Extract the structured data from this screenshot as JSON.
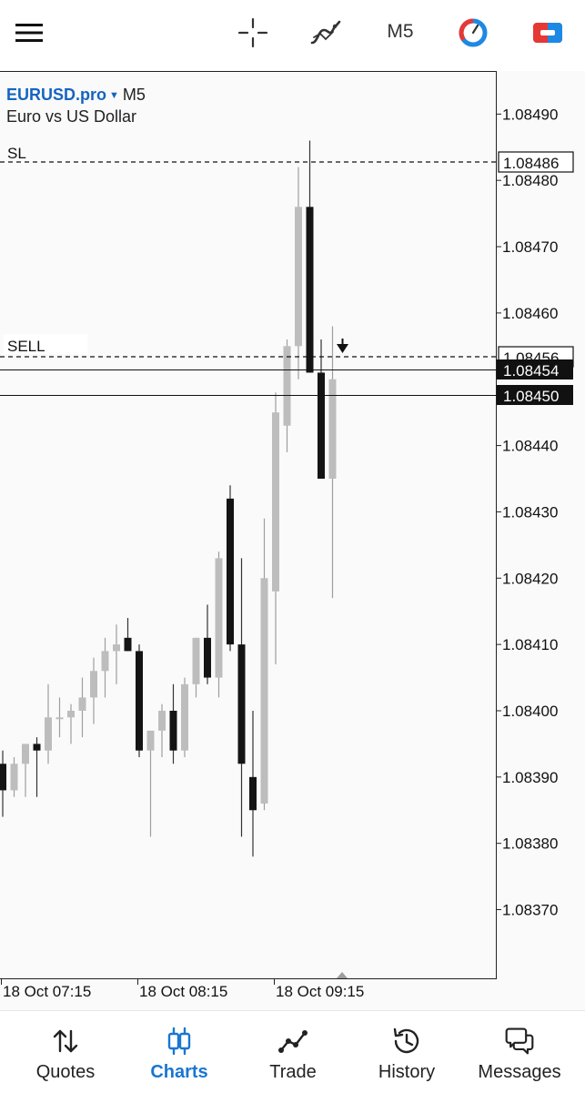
{
  "toolbar": {
    "menu_icon": "hamburger-menu-icon",
    "crosshair_icon": "crosshair-icon",
    "indicators_icon": "indicator-curve-icon",
    "timeframe": "M5",
    "oneclick_icon": "one-click-trading-icon",
    "trade_icon": "trade-ticket-icon",
    "colors": {
      "oneclick_blue": "#1e88e5",
      "oneclick_red": "#e53935",
      "trade_red": "#e53935",
      "trade_blue": "#1e88e5"
    }
  },
  "symbol": {
    "name": "EURUSD.pro",
    "dropdown_icon": "caret-down-icon",
    "timeframe": "M5",
    "description": "Euro vs US Dollar"
  },
  "levels": {
    "sl_label": "SL",
    "sl_price": "1.08486",
    "sell_label": "SELL",
    "sell_price": "1.08456",
    "ask_price": "1.08454",
    "bid_price": "1.08450"
  },
  "chart_data": {
    "type": "candlestick",
    "symbol": "EURUSD.pro",
    "timeframe": "M5",
    "y_ticks": [
      "1.08490",
      "1.08480",
      "1.08470",
      "1.08460",
      "1.08440",
      "1.08430",
      "1.08420",
      "1.08410",
      "1.08400",
      "1.08390",
      "1.08380",
      "1.08370"
    ],
    "x_ticks": [
      "18 Oct 07:15",
      "18 Oct 08:15",
      "18 Oct 09:15"
    ],
    "ylim": [
      1.083595,
      1.084965
    ],
    "candles": [
      {
        "o": 1.08392,
        "h": 1.08394,
        "l": 1.08384,
        "c": 1.08388
      },
      {
        "o": 1.08388,
        "h": 1.08393,
        "l": 1.08387,
        "c": 1.08392
      },
      {
        "o": 1.08392,
        "h": 1.08395,
        "l": 1.08387,
        "c": 1.08395
      },
      {
        "o": 1.08395,
        "h": 1.08396,
        "l": 1.08387,
        "c": 1.08394
      },
      {
        "o": 1.08394,
        "h": 1.08404,
        "l": 1.08392,
        "c": 1.08399
      },
      {
        "o": 1.08399,
        "h": 1.08402,
        "l": 1.08396,
        "c": 1.08399
      },
      {
        "o": 1.08399,
        "h": 1.08401,
        "l": 1.08395,
        "c": 1.084
      },
      {
        "o": 1.084,
        "h": 1.08405,
        "l": 1.08396,
        "c": 1.08402
      },
      {
        "o": 1.08402,
        "h": 1.08408,
        "l": 1.08398,
        "c": 1.08406
      },
      {
        "o": 1.08406,
        "h": 1.08411,
        "l": 1.08402,
        "c": 1.08409
      },
      {
        "o": 1.08409,
        "h": 1.08413,
        "l": 1.08404,
        "c": 1.0841
      },
      {
        "o": 1.08411,
        "h": 1.08414,
        "l": 1.08409,
        "c": 1.08409
      },
      {
        "o": 1.08409,
        "h": 1.0841,
        "l": 1.08393,
        "c": 1.08394
      },
      {
        "o": 1.08394,
        "h": 1.08396,
        "l": 1.08381,
        "c": 1.08397
      },
      {
        "o": 1.08397,
        "h": 1.08401,
        "l": 1.08393,
        "c": 1.084
      },
      {
        "o": 1.084,
        "h": 1.08404,
        "l": 1.08392,
        "c": 1.08394
      },
      {
        "o": 1.08394,
        "h": 1.08405,
        "l": 1.08393,
        "c": 1.08404
      },
      {
        "o": 1.08404,
        "h": 1.08411,
        "l": 1.08402,
        "c": 1.08411
      },
      {
        "o": 1.08411,
        "h": 1.08416,
        "l": 1.08404,
        "c": 1.08405
      },
      {
        "o": 1.08405,
        "h": 1.08424,
        "l": 1.08402,
        "c": 1.08423
      },
      {
        "o": 1.08432,
        "h": 1.08434,
        "l": 1.08409,
        "c": 1.0841
      },
      {
        "o": 1.0841,
        "h": 1.08423,
        "l": 1.08381,
        "c": 1.08392
      },
      {
        "o": 1.0839,
        "h": 1.084,
        "l": 1.08378,
        "c": 1.08385
      },
      {
        "o": 1.08386,
        "h": 1.08429,
        "l": 1.08385,
        "c": 1.0842
      },
      {
        "o": 1.08418,
        "h": 1.08448,
        "l": 1.08407,
        "c": 1.08445
      },
      {
        "o": 1.08443,
        "h": 1.08456,
        "l": 1.08439,
        "c": 1.08455
      },
      {
        "o": 1.08455,
        "h": 1.08482,
        "l": 1.0845,
        "c": 1.08476
      },
      {
        "o": 1.08476,
        "h": 1.08486,
        "l": 1.08451,
        "c": 1.08451
      },
      {
        "o": 1.08451,
        "h": 1.08456,
        "l": 1.08435,
        "c": 1.08435
      },
      {
        "o": 1.08435,
        "h": 1.08458,
        "l": 1.08417,
        "c": 1.0845
      }
    ],
    "colors": {
      "bull": "#bdbdbd",
      "bear": "#141414",
      "wick": "#333333",
      "line": "#111111",
      "background": "#fafafa"
    }
  },
  "nav": [
    {
      "label": "Quotes",
      "icon": "quotes-arrows-icon",
      "active": false
    },
    {
      "label": "Charts",
      "icon": "candlestick-chart-icon",
      "active": true
    },
    {
      "label": "Trade",
      "icon": "trade-line-icon",
      "active": false
    },
    {
      "label": "History",
      "icon": "history-clock-icon",
      "active": false
    },
    {
      "label": "Messages",
      "icon": "messages-chat-icon",
      "active": false
    }
  ],
  "nav_colors": {
    "active": "#1976d2",
    "inactive": "#222222"
  }
}
